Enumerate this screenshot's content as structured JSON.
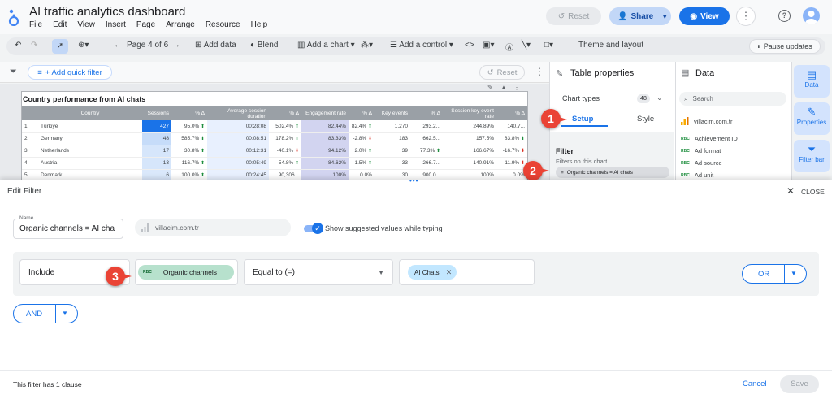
{
  "header": {
    "title": "AI traffic analytics dashboard",
    "menus": [
      "File",
      "Edit",
      "View",
      "Insert",
      "Page",
      "Arrange",
      "Resource",
      "Help"
    ],
    "reset_label": "Reset",
    "share_label": "Share",
    "view_label": "View"
  },
  "toolbar": {
    "page_label": "Page 4 of 6",
    "add_data": "Add data",
    "blend": "Blend",
    "add_chart": "Add a chart",
    "add_control": "Add a control",
    "theme": "Theme and layout",
    "pause": "Pause updates"
  },
  "filterbar": {
    "add_quick_filter": "+ Add quick filter",
    "reset_label": "Reset"
  },
  "chart": {
    "title": "Country performance from AI chats",
    "columns": [
      "",
      "Country",
      "Sessions",
      "% Δ",
      "Average session duration",
      "% Δ",
      "Engagement rate",
      "% Δ",
      "Key events",
      "% Δ",
      "Session key event rate",
      "% Δ"
    ],
    "rows": [
      {
        "n": "1.",
        "country": "Türkiye",
        "sessions": "427",
        "d1": "95.0%",
        "dur": "00:28:08",
        "d2": "502.4%",
        "eng": "82.44%",
        "d3": "82.4%",
        "key": "1,270",
        "d4": "293.2...",
        "rate": "244.89%",
        "d5": "140.7...",
        "t1": "up",
        "t2": "up",
        "t3": "up",
        "t4": "",
        "t5": ""
      },
      {
        "n": "2.",
        "country": "Germany",
        "sessions": "48",
        "d1": "585.7%",
        "dur": "00:08:51",
        "d2": "178.2%",
        "eng": "83.33%",
        "d3": "-2.8%",
        "key": "183",
        "d4": "662.5...",
        "rate": "157.5%",
        "d5": "83.8%",
        "t1": "up",
        "t2": "up",
        "t3": "dn",
        "t4": "",
        "t5": "up"
      },
      {
        "n": "3.",
        "country": "Netherlands",
        "sessions": "17",
        "d1": "30.8%",
        "dur": "00:12:31",
        "d2": "-40.1%",
        "eng": "94.12%",
        "d3": "2.0%",
        "key": "39",
        "d4": "77.3%",
        "rate": "166.67%",
        "d5": "-16.7%",
        "t1": "up",
        "t2": "dn",
        "t3": "up",
        "t4": "up",
        "t5": "dn"
      },
      {
        "n": "4.",
        "country": "Austria",
        "sessions": "13",
        "d1": "116.7%",
        "dur": "00:05:49",
        "d2": "54.8%",
        "eng": "84.62%",
        "d3": "1.5%",
        "key": "33",
        "d4": "266.7...",
        "rate": "140.91%",
        "d5": "-11.9%",
        "t1": "up",
        "t2": "up",
        "t3": "up",
        "t4": "",
        "t5": "dn"
      },
      {
        "n": "5.",
        "country": "Denmark",
        "sessions": "6",
        "d1": "100.0%",
        "dur": "00:24:45",
        "d2": "90,306...",
        "eng": "100%",
        "d3": "0.0%",
        "key": "30",
        "d4": "900.0...",
        "rate": "100%",
        "d5": "0.0%",
        "t1": "up",
        "t2": "",
        "t3": "",
        "t4": "",
        "t5": ""
      }
    ]
  },
  "table_properties": {
    "title": "Table properties",
    "chart_types": "Chart types",
    "chart_types_count": "48",
    "tab_setup": "Setup",
    "tab_style": "Style",
    "filter_heading": "Filter",
    "filters_on_chart": "Filters on this chart",
    "filter_chip": "Organic channels = AI chats"
  },
  "data_panel": {
    "title": "Data",
    "search_placeholder": "Search",
    "source": "villacim.com.tr",
    "fields": [
      "Achievement ID",
      "Ad format",
      "Ad source",
      "Ad unit"
    ]
  },
  "rail": {
    "data": "Data",
    "properties": "Properties",
    "filter_bar": "Filter bar"
  },
  "callouts": [
    "1",
    "2",
    "3"
  ],
  "modal": {
    "title": "Edit Filter",
    "close_label": "CLOSE",
    "name_label": "Name",
    "name_value": "Organic channels = AI cha",
    "source": "villacim.com.tr",
    "show_suggested": "Show suggested values while typing",
    "include": "Include",
    "dimension_chip": "Organic channels",
    "operator": "Equal to (=)",
    "value_chip": "AI Chats",
    "or_label": "OR",
    "and_label": "AND",
    "footer_info": "This filter has 1 clause",
    "cancel": "Cancel",
    "save": "Save"
  },
  "colors": {
    "accent": "#1a73e8",
    "callout": "#ea4335",
    "chip_green": "#b7e1cd",
    "chip_blue": "#c2e7ff"
  }
}
